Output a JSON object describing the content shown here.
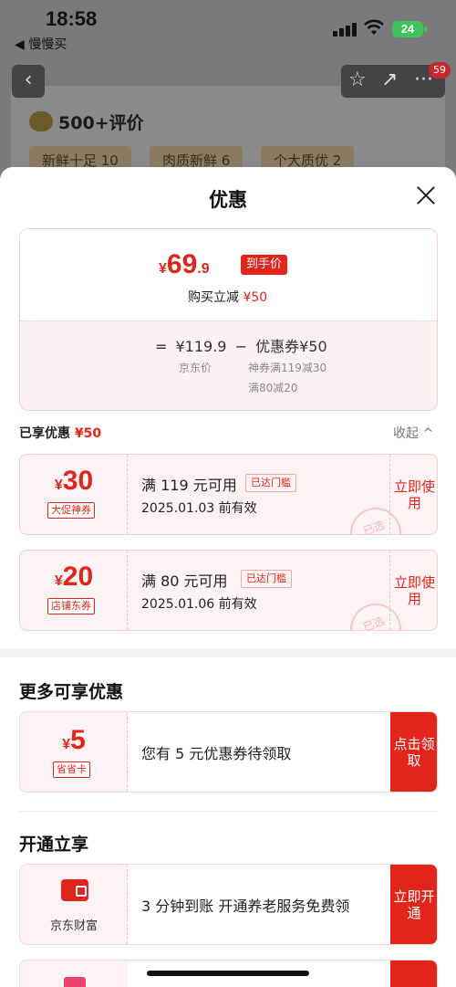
{
  "status": {
    "time": "18:58",
    "back_app": "◀ 慢慢买",
    "battery": "24"
  },
  "background": {
    "badge": "59",
    "review_title": "500+评价",
    "tags": [
      "新鲜十足 10",
      "肉质新鲜 6",
      "个大质优 2"
    ]
  },
  "sheet": {
    "title": "优惠",
    "price": {
      "yen": "¥",
      "int": "69",
      "dec": ".9",
      "tag": "到手价",
      "reduce_label": "购买立减",
      "reduce_value": "¥50"
    },
    "formula": {
      "eq": "=",
      "jd_price": "¥119.9",
      "minus": "−",
      "coupon": "优惠券¥50",
      "jd_label": "京东价",
      "coupon_sub1": "神券满119减30",
      "coupon_sub2": "满80减20"
    },
    "enjoyed": {
      "label": "已享优惠",
      "value": "¥50",
      "collapse": "收起 ^"
    },
    "coupons": [
      {
        "yen": "¥",
        "amount": "30",
        "tag": "大促神券",
        "condition": "满 119 元可用",
        "reached": "已达门槛",
        "expiry": "2025.01.03 前有效",
        "action": "立即使用",
        "stamp": "已选"
      },
      {
        "yen": "¥",
        "amount": "20",
        "tag": "店铺东券",
        "condition": "满 80 元可用",
        "reached": "已达门槛",
        "expiry": "2025.01.06 前有效",
        "action": "立即使用",
        "stamp": "已选"
      }
    ],
    "more": {
      "title": "更多可享优惠",
      "yen": "¥",
      "amount": "5",
      "tag": "省省卡",
      "message": "您有 5 元优惠券待领取",
      "action": "点击领取"
    },
    "open": {
      "title": "开通立享",
      "brand": "京东财富",
      "message": "3 分钟到账 开通养老服务免费领",
      "action": "立即开通"
    }
  }
}
